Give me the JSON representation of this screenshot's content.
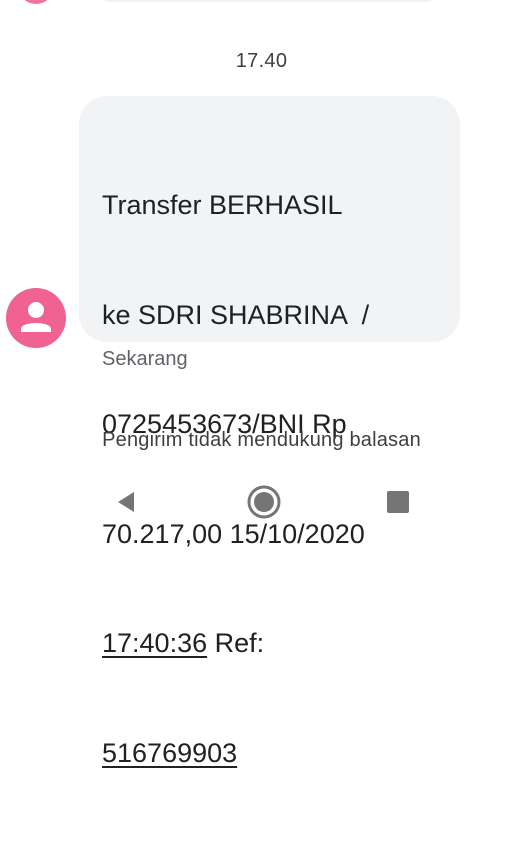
{
  "conversation": {
    "time_divider": "17.40",
    "message": {
      "lines": [
        "Transfer BERHASIL",
        "ke SDRI SHABRINA  /",
        "0725453673/BNI Rp",
        "70.217,00 15/10/2020"
      ],
      "last_line_link": "17:40:36",
      "last_line_suffix": " Ref:",
      "ref_number": "516769903",
      "status": "Sekarang"
    },
    "sender_avatar_icon": "person-icon",
    "reply_notice": "Pengirim tidak mendukung balasan"
  },
  "navbar": {
    "back_icon": "back-triangle-icon",
    "home_icon": "home-circle-icon",
    "recents_icon": "recents-square-icon"
  },
  "colors": {
    "avatar": "#f06292",
    "bubble": "#f1f3f4",
    "nav_icon": "#757575"
  }
}
